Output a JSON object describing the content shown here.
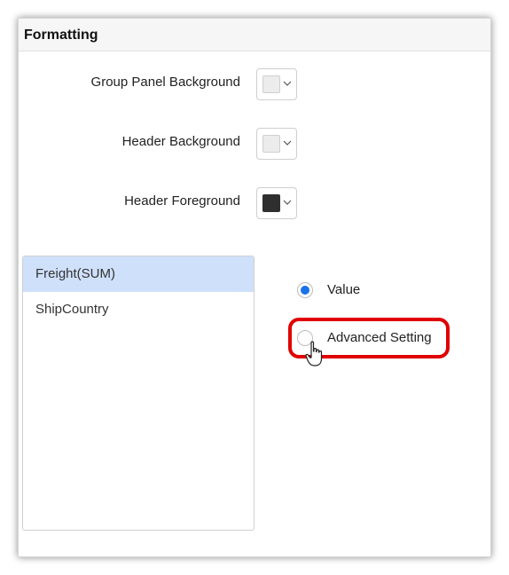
{
  "panel": {
    "title": "Formatting"
  },
  "rows": [
    {
      "label": "Group Panel Background",
      "color": "#ececec"
    },
    {
      "label": "Header Background",
      "color": "#ececec"
    },
    {
      "label": "Header Foreground",
      "color": "#2f2f2f"
    }
  ],
  "fields": {
    "items": [
      {
        "label": "Freight(SUM)",
        "selected": true
      },
      {
        "label": "ShipCountry",
        "selected": false
      }
    ]
  },
  "options": {
    "value_label": "Value",
    "advanced_label": "Advanced Setting",
    "selected": "Value"
  },
  "colors": {
    "accent": "#1a73e8",
    "highlight": "#e00000",
    "selected_item_bg": "#cfe0fb"
  },
  "icons": {
    "dropdown": "chevron-down-icon",
    "cursor": "hand-pointer-icon"
  }
}
